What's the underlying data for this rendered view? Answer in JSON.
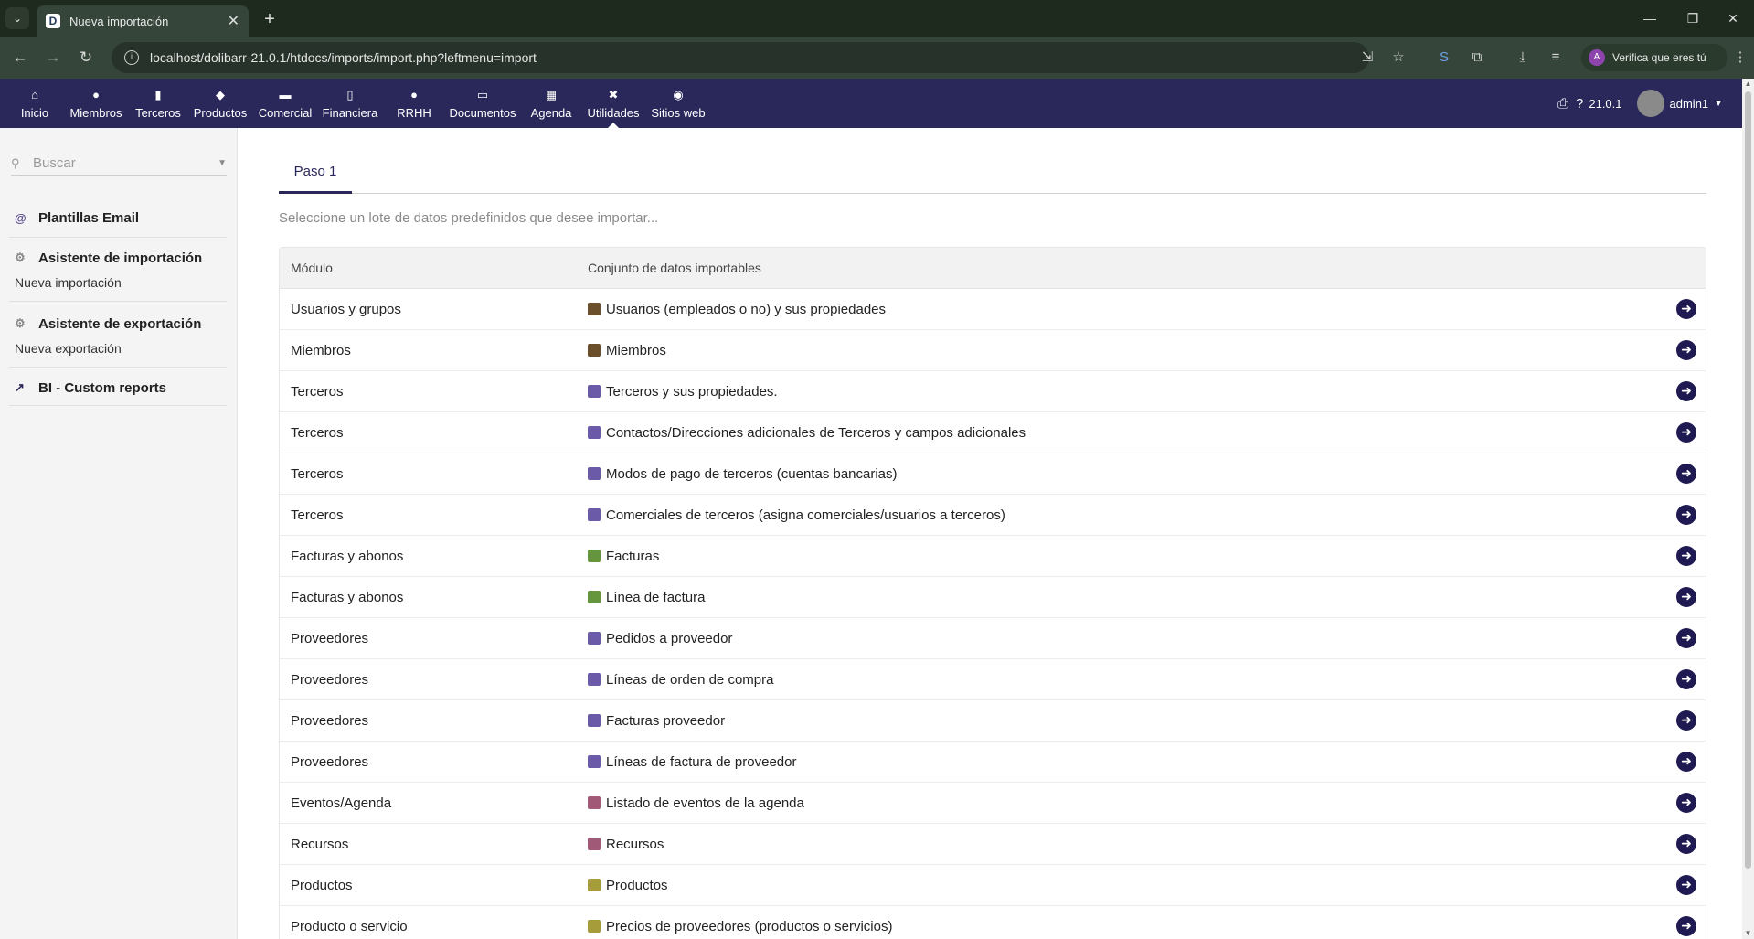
{
  "browser": {
    "tab_title": "Nueva importación",
    "url": "localhost/dolibarr-21.0.1/htdocs/imports/import.php?leftmenu=import",
    "profile_label": "Verifica que eres tú",
    "profile_initial": "A"
  },
  "topmenu": {
    "items": [
      {
        "label": "Inicio",
        "icon": "home-icon"
      },
      {
        "label": "Miembros",
        "icon": "user-icon"
      },
      {
        "label": "Terceros",
        "icon": "building-icon"
      },
      {
        "label": "Productos",
        "icon": "cube-icon"
      },
      {
        "label": "Comercial",
        "icon": "briefcase-icon"
      },
      {
        "label": "Financiera",
        "icon": "invoice-icon"
      },
      {
        "label": "RRHH",
        "icon": "user-tie-icon"
      },
      {
        "label": "Documentos",
        "icon": "folder-icon"
      },
      {
        "label": "Agenda",
        "icon": "calendar-icon"
      },
      {
        "label": "Utilidades",
        "icon": "tools-icon"
      },
      {
        "label": "Sitios web",
        "icon": "globe-icon"
      }
    ],
    "active": "Utilidades",
    "version": "21.0.1",
    "user": "admin1"
  },
  "sidebar": {
    "search_placeholder": "Buscar",
    "email_templates": "Plantillas Email",
    "import_wizard": "Asistente de importación",
    "new_import": "Nueva importación",
    "export_wizard": "Asistente de exportación",
    "new_export": "Nueva exportación",
    "bi_reports": "BI - Custom reports"
  },
  "main": {
    "tab_step1": "Paso 1",
    "subtitle": "Seleccione un lote de datos predefinidos que desee importar...",
    "col_module": "Módulo",
    "col_dataset": "Conjunto de datos importables",
    "rows": [
      {
        "module": "Usuarios y grupos",
        "dataset": "Usuarios (empleados o no) y sus propiedades",
        "icon_color": "#6b4f2a"
      },
      {
        "module": "Miembros",
        "dataset": "Miembros",
        "icon_color": "#6b4f2a"
      },
      {
        "module": "Terceros",
        "dataset": "Terceros y sus propiedades.",
        "icon_color": "#6a5aa8"
      },
      {
        "module": "Terceros",
        "dataset": "Contactos/Direcciones adicionales de Terceros y campos adicionales",
        "icon_color": "#6a5aa8"
      },
      {
        "module": "Terceros",
        "dataset": "Modos de pago de terceros (cuentas bancarias)",
        "icon_color": "#6a5aa8"
      },
      {
        "module": "Terceros",
        "dataset": "Comerciales de terceros (asigna comerciales/usuarios a terceros)",
        "icon_color": "#6a5aa8"
      },
      {
        "module": "Facturas y abonos",
        "dataset": "Facturas",
        "icon_color": "#65953d"
      },
      {
        "module": "Facturas y abonos",
        "dataset": "Línea de factura",
        "icon_color": "#65953d"
      },
      {
        "module": "Proveedores",
        "dataset": "Pedidos a proveedor",
        "icon_color": "#6a5aa8"
      },
      {
        "module": "Proveedores",
        "dataset": "Líneas de orden de compra",
        "icon_color": "#6a5aa8"
      },
      {
        "module": "Proveedores",
        "dataset": "Facturas proveedor",
        "icon_color": "#6a5aa8"
      },
      {
        "module": "Proveedores",
        "dataset": "Líneas de factura de proveedor",
        "icon_color": "#6a5aa8"
      },
      {
        "module": "Eventos/Agenda",
        "dataset": "Listado de eventos de la agenda",
        "icon_color": "#a05a78"
      },
      {
        "module": "Recursos",
        "dataset": "Recursos",
        "icon_color": "#a05a78"
      },
      {
        "module": "Productos",
        "dataset": "Productos",
        "icon_color": "#a69c3a"
      },
      {
        "module": "Producto o servicio",
        "dataset": "Precios de proveedores (productos o servicios)",
        "icon_color": "#a69c3a"
      }
    ]
  }
}
